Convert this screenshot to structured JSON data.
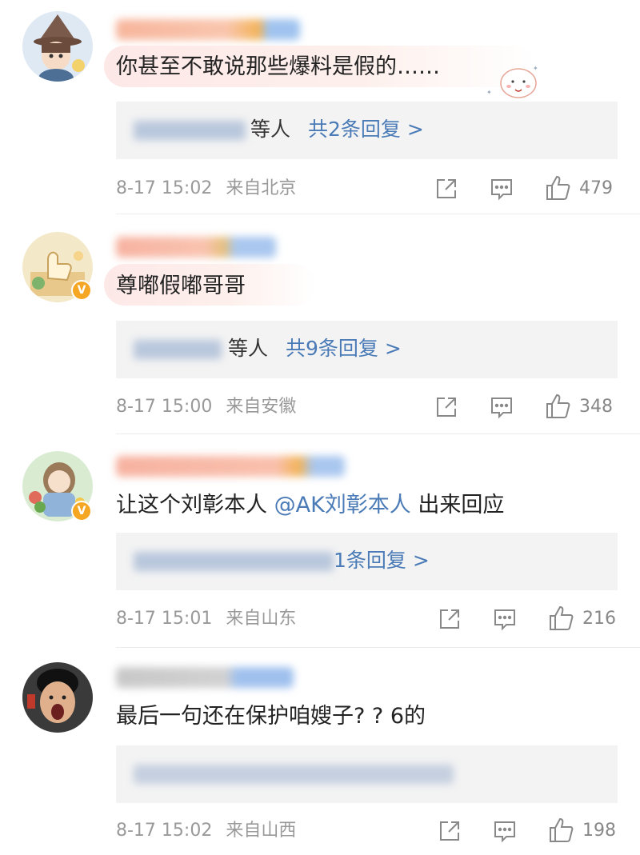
{
  "comments": [
    {
      "text": "你甚至不敢说那些爆料是假的……",
      "reply_who": "等人",
      "reply_count": "共2条回复 >",
      "time": "8-17 15:02",
      "source": "来自北京",
      "likes": "479"
    },
    {
      "text": "尊嘟假嘟哥哥",
      "reply_who": "等人",
      "reply_count": "共9条回复 >",
      "time": "8-17 15:00",
      "source": "来自安徽",
      "likes": "348"
    },
    {
      "text_prefix": "让这个刘彰本人",
      "mention": "@AK刘彰本人",
      "text_suffix": "出来回应",
      "reply_count": "1条回复 >",
      "time": "8-17 15:01",
      "source": "来自山东",
      "likes": "216"
    },
    {
      "text": "最后一句还在保护咱嫂子? ? 6的",
      "time": "8-17 15:02",
      "source": "来自山西",
      "likes": "198"
    }
  ],
  "colors": {
    "link": "#4a7bb7",
    "verified_badge": "#f5a623",
    "meta_gray": "#999999",
    "reply_bg": "#f3f3f3"
  },
  "icons": [
    "share-icon",
    "comment-icon",
    "like-icon",
    "verified-icon"
  ],
  "verified_symbol": "V"
}
